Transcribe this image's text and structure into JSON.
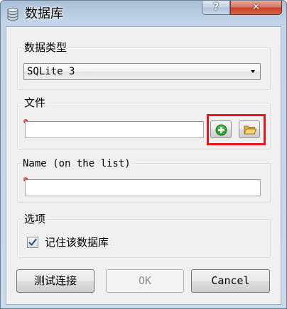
{
  "window": {
    "title": "数据库",
    "help_label": "?",
    "close_label": "✕"
  },
  "groups": {
    "db_type": {
      "title": "数据类型",
      "selected": "SQLite 3"
    },
    "file": {
      "title": "文件",
      "value": ""
    },
    "name": {
      "title": "Name (on the list)",
      "value": ""
    },
    "options": {
      "title": "选项",
      "remember_label": "记住该数据库",
      "remember_checked": true
    }
  },
  "buttons": {
    "test_label": "测试连接",
    "ok_label": "OK",
    "cancel_label": "Cancel"
  },
  "icons": {
    "app": "database-icon",
    "create": "green-plus-icon",
    "browse": "folder-icon",
    "required": "red-required-dot-icon"
  },
  "colors": {
    "highlight": "#e8141e",
    "plus_green": "#2fa52f",
    "folder_yellow": "#f0c75a"
  }
}
